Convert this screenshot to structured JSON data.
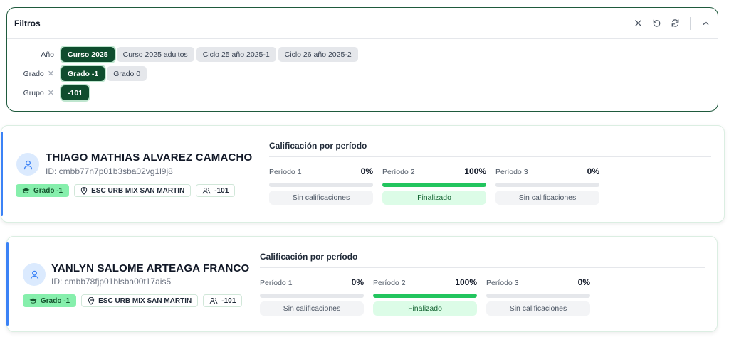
{
  "filters": {
    "title": "Filtros",
    "rows": [
      {
        "label": "Año",
        "clearable": false,
        "chips": [
          {
            "label": "Curso 2025",
            "selected": true
          },
          {
            "label": "Curso 2025 adultos",
            "selected": false
          },
          {
            "label": "Ciclo 25 año 2025-1",
            "selected": false
          },
          {
            "label": "Ciclo 26 año 2025-2",
            "selected": false
          }
        ]
      },
      {
        "label": "Grado",
        "clearable": true,
        "chips": [
          {
            "label": "Grado -1",
            "selected": true
          },
          {
            "label": "Grado 0",
            "selected": false
          }
        ]
      },
      {
        "label": "Grupo",
        "clearable": true,
        "chips": [
          {
            "label": "-101",
            "selected": true
          }
        ]
      }
    ]
  },
  "students": [
    {
      "name": "THIAGO MATHIAS ALVAREZ CAMACHO",
      "id": "ID: cmbb77n7p01b3sba02vg1l9j8",
      "grade": "Grado -1",
      "school": "ESC URB MIX SAN MARTIN",
      "group": "-101",
      "grades_title": "Calificación por período",
      "periods": [
        {
          "label": "Período 1",
          "pct": "0%",
          "progress": 0,
          "status": "Sin calificaciones"
        },
        {
          "label": "Período 2",
          "pct": "100%",
          "progress": 100,
          "status": "Finalizado"
        },
        {
          "label": "Período 3",
          "pct": "0%",
          "progress": 0,
          "status": "Sin calificaciones"
        }
      ]
    },
    {
      "name": "YANLYN SALOME ARTEAGA FRANCO",
      "id": "ID: cmbb78fjp01blsba00t17ais5",
      "grade": "Grado -1",
      "school": "ESC URB MIX SAN MARTIN",
      "group": "-101",
      "grades_title": "Calificación por período",
      "periods": [
        {
          "label": "Período 1",
          "pct": "0%",
          "progress": 0,
          "status": "Sin calificaciones"
        },
        {
          "label": "Período 2",
          "pct": "100%",
          "progress": 100,
          "status": "Finalizado"
        },
        {
          "label": "Período 3",
          "pct": "0%",
          "progress": 0,
          "status": "Sin calificaciones"
        }
      ]
    }
  ],
  "colors": {
    "accent": "#0f4d2e",
    "progress": "#22c55e",
    "grade_tag": "#86efac",
    "card_edge": "#3b82f6"
  }
}
